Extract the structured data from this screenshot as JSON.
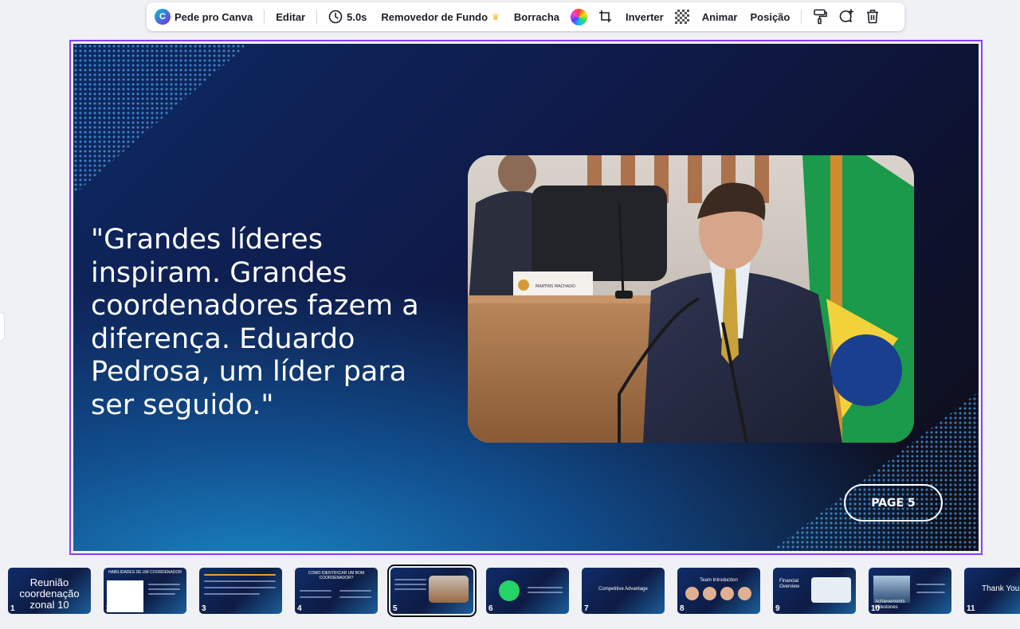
{
  "toolbar": {
    "ai_label": "Pede pro Canva",
    "edit_label": "Editar",
    "duration_label": "5.0s",
    "bg_remover_label": "Removedor de Fundo",
    "eraser_label": "Borracha",
    "flip_label": "Inverter",
    "animate_label": "Animar",
    "position_label": "Posição"
  },
  "slide": {
    "quote": "\"Grandes líderes inspiram. Grandes coordenadores fazem a diferença. Eduardo Pedrosa, um líder para ser seguido.\"",
    "page_label": "PAGE 5",
    "nameplate_text": "MARTINS MACHADO"
  },
  "filmstrip": {
    "thumbs": [
      {
        "num": "1",
        "title": "Reunião coordenação zonal 10"
      },
      {
        "num": "2",
        "title": "HABILIDADES DE UM COORDENADOR"
      },
      {
        "num": "3",
        "title": ""
      },
      {
        "num": "4",
        "title": "COMO IDENTIFICAR UM BOM COORDENADOR?"
      },
      {
        "num": "5",
        "title": ""
      },
      {
        "num": "6",
        "title": ""
      },
      {
        "num": "7",
        "title": "Competitive Advantage"
      },
      {
        "num": "8",
        "title": "Team Introduction"
      },
      {
        "num": "9",
        "title": "Financial Overview"
      },
      {
        "num": "10",
        "title": "Achievements Milestones"
      },
      {
        "num": "11",
        "title": "Thank You"
      }
    ]
  },
  "colors": {
    "selection": "#8b3dff",
    "slide_dark": "#0e0f18",
    "slide_blue": "#1a83c2"
  }
}
